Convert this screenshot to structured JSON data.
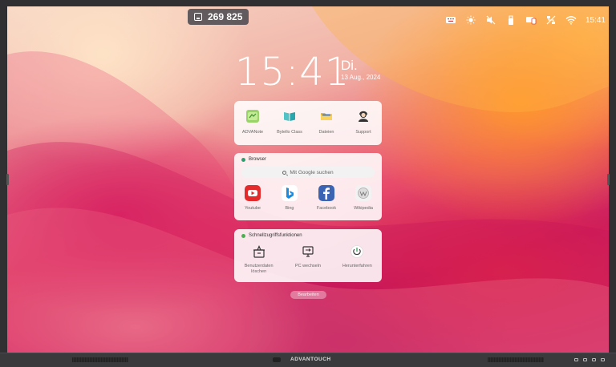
{
  "counter": {
    "value": "269 825",
    "icon": "floppy-icon"
  },
  "status_bar": {
    "icons": [
      "keyboard-icon",
      "brightness-icon",
      "mute-icon",
      "usb-icon",
      "screen-share-icon",
      "network-off-icon",
      "wifi-icon"
    ],
    "time": "15:41"
  },
  "clock": {
    "time": "15:41",
    "day": "Di.",
    "date": "13 Aug., 2024"
  },
  "apps_panel": {
    "items": [
      {
        "label": "ADVANote",
        "icon": "advanote-icon",
        "color": "#9ad36a"
      },
      {
        "label": "Bytello Class",
        "icon": "book-icon",
        "color": "#4fc3c6"
      },
      {
        "label": "Dateien",
        "icon": "folder-icon",
        "color": "#f5b921"
      },
      {
        "label": "Support",
        "icon": "support-agent-icon",
        "color": "#333333"
      }
    ]
  },
  "browser_panel": {
    "title": "Browser",
    "search_placeholder": "Mit Google suchen",
    "items": [
      {
        "label": "Youtube",
        "icon": "youtube-icon",
        "color": "#e32b2b"
      },
      {
        "label": "Bing",
        "icon": "bing-icon",
        "color": "#1c8bdf"
      },
      {
        "label": "Facebook",
        "icon": "facebook-icon",
        "color": "#3b65b3"
      },
      {
        "label": "Wikipedia",
        "icon": "wikipedia-icon",
        "color": "#dddddd"
      }
    ]
  },
  "quick_panel": {
    "title": "Schnellzugriffsfunktionen",
    "items": [
      {
        "label": "Benutzerdaten löschen",
        "icon": "clear-data-icon"
      },
      {
        "label": "PC wechseln",
        "icon": "pc-switch-icon"
      },
      {
        "label": "Herunterfahren",
        "icon": "power-icon"
      }
    ]
  },
  "edit_button": {
    "label": "Bearbeiten"
  },
  "brand": {
    "name": "ADVANTOUCH"
  },
  "colors": {
    "panel_bg": "#ffffff",
    "accent_green": "#4caf50"
  }
}
